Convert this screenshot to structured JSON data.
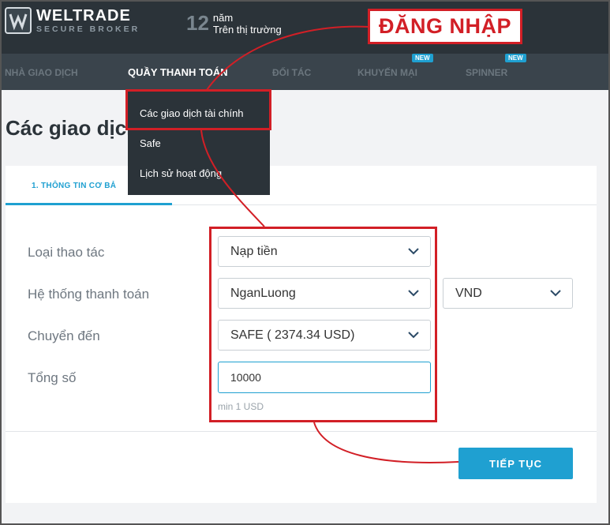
{
  "header": {
    "logo_name": "WELTRADE",
    "logo_sub": "SECURE BROKER",
    "years_number": "12",
    "years_unit": "năm",
    "years_caption": "Trên thị trường",
    "login_label": "ĐĂNG NHẬP"
  },
  "nav": {
    "items": [
      {
        "label": "NHÀ GIAO DỊCH"
      },
      {
        "label": "QUẦY THANH TOÁN"
      },
      {
        "label": "ĐỐI TÁC"
      },
      {
        "label": "KHUYẾN MẠI"
      },
      {
        "label": "SPINNER"
      }
    ],
    "badges": [
      "NEW",
      "NEW"
    ]
  },
  "dropdown": {
    "items": [
      {
        "label": "Các giao dịch tài chính"
      },
      {
        "label": "Safe"
      },
      {
        "label": "Lịch sử hoạt động"
      }
    ]
  },
  "page": {
    "title": "Các giao dịch"
  },
  "form": {
    "tab_label": "1. THÔNG TIN CƠ BẢ",
    "fields": {
      "operation_label": "Loại thao tác",
      "operation_value": "Nạp tiền",
      "payment_system_label": "Hệ thống thanh toán",
      "payment_system_value": "NganLuong",
      "currency_value": "VND",
      "transfer_to_label": "Chuyển đến",
      "transfer_to_value": "SAFE ( 2374.34 USD)",
      "total_label": "Tổng số",
      "total_value": "10000",
      "min_hint": "min 1 USD"
    },
    "continue_label": "TIẾP TỤC"
  },
  "colors": {
    "accent": "#1fa0d1",
    "highlight": "#d21f26",
    "header_bg": "#2b3339",
    "nav_bg": "#3a444c"
  }
}
